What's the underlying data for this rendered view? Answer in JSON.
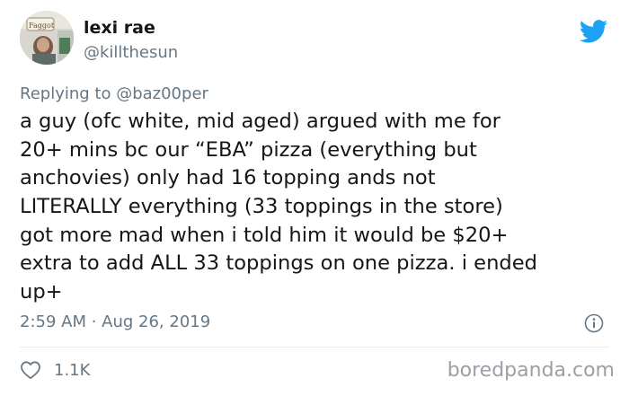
{
  "author": {
    "display_name": "lexi rae",
    "handle": "@killthesun",
    "avatar_sign_text": "Faggot"
  },
  "reply": {
    "prefix": "Replying to ",
    "mention": "@baz00per"
  },
  "tweet": {
    "lines": [
      "a guy (ofc white, mid aged) argued with me for",
      "20+ mins bc our “EBA” pizza (everything but",
      "anchovies) only had 16 topping ands not",
      "LITERALLY everything (33 toppings in the store)",
      "got more mad when i told him it would be $20+",
      "extra to add ALL 33 toppings on one pizza. i ended",
      "up+"
    ],
    "timestamp": "2:59 AM · Aug 26, 2019"
  },
  "actions": {
    "like_count": "1.1K"
  },
  "watermark": "boredpanda.com",
  "icons": {
    "brand": "twitter-bird-icon",
    "info": "info-icon",
    "like": "heart-icon"
  },
  "colors": {
    "twitter_blue": "#1da1f2",
    "text_primary": "#14171a",
    "text_secondary": "#657786",
    "divider": "#e6ecf0",
    "watermark": "#9aa0a6"
  }
}
